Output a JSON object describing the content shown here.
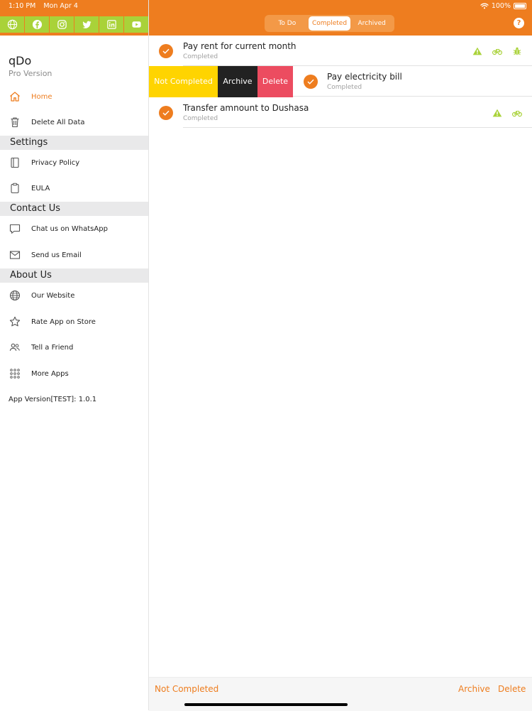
{
  "status_bar": {
    "time": "1:10 PM",
    "date": "Mon Apr 4",
    "battery": "100%"
  },
  "colors": {
    "accent": "#ee7d1f",
    "social_green": "#a9d239",
    "warning": "#a9d239",
    "delete": "#ec4c60",
    "not_completed": "#ffd400"
  },
  "social": [
    "globe-icon",
    "facebook-icon",
    "instagram-icon",
    "twitter-icon",
    "linkedin-icon",
    "youtube-icon"
  ],
  "sidebar": {
    "app_name": "qDo",
    "edition": "Pro Version",
    "items": [
      {
        "label": "Home",
        "icon": "home-icon"
      },
      {
        "label": "Delete All Data",
        "icon": "trash-icon"
      }
    ],
    "sections": [
      {
        "title": "Settings",
        "items": [
          {
            "label": "Privacy Policy",
            "icon": "book-icon"
          },
          {
            "label": "EULA",
            "icon": "clipboard-icon"
          }
        ]
      },
      {
        "title": "Contact Us",
        "items": [
          {
            "label": "Chat us on WhatsApp",
            "icon": "chat-icon"
          },
          {
            "label": "Send us Email",
            "icon": "mail-icon"
          }
        ]
      },
      {
        "title": "About Us",
        "items": [
          {
            "label": "Our Website",
            "icon": "globe-icon"
          },
          {
            "label": "Rate App on Store",
            "icon": "star-icon"
          },
          {
            "label": "Tell a Friend",
            "icon": "people-icon"
          },
          {
            "label": "More Apps",
            "icon": "grid-icon"
          }
        ]
      }
    ],
    "app_version": "App Version[TEST]: 1.0.1"
  },
  "segments": [
    "To Do",
    "Completed",
    "Archived"
  ],
  "selected_segment": "Completed",
  "help": "?",
  "tasks": [
    {
      "title": "Pay rent for current month",
      "status": "Completed",
      "tags": [
        "warning-icon",
        "bicycle-icon",
        "bug-icon"
      ]
    },
    {
      "title": "Pay electricity bill",
      "status": "Completed",
      "tags": []
    },
    {
      "title": "Transfer amnount to Dushasa",
      "status": "Completed",
      "tags": [
        "warning-icon",
        "bicycle-icon"
      ]
    }
  ],
  "swipe_actions": {
    "not_completed": "Not Completed",
    "archive": "Archive",
    "delete": "Delete"
  },
  "toolbar": {
    "not_completed": "Not Completed",
    "archive": "Archive",
    "delete": "Delete"
  }
}
